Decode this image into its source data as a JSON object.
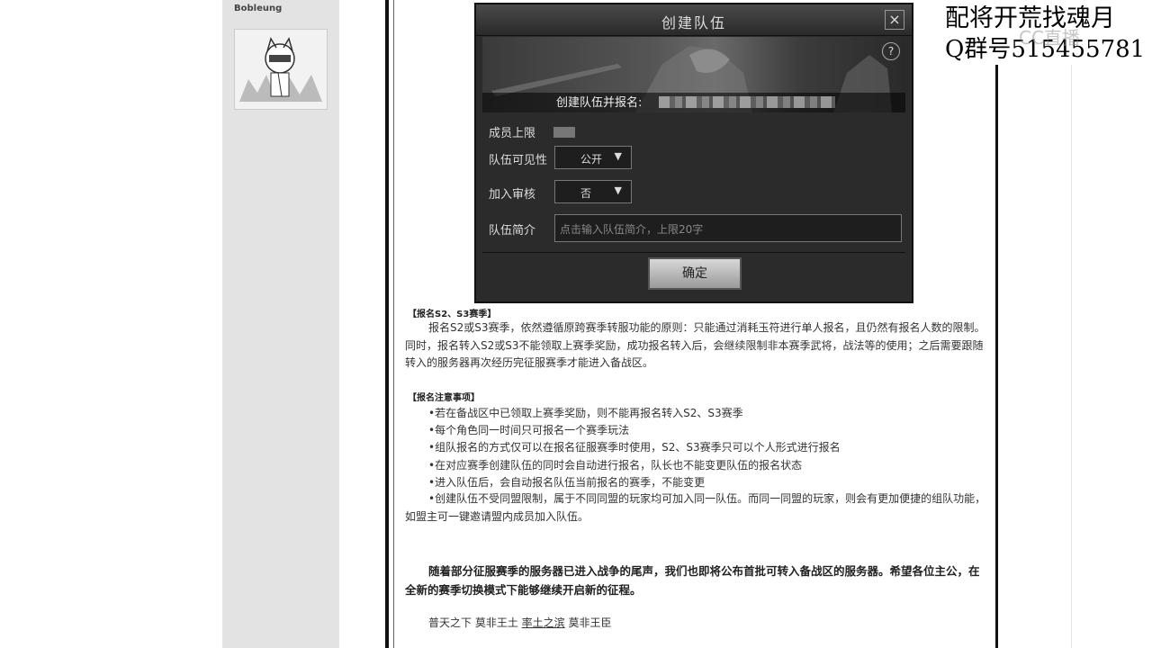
{
  "sidebar": {
    "username": "Bobleung"
  },
  "dialog": {
    "title": "创建队伍",
    "close_glyph": "×",
    "help_glyph": "?",
    "banner_label": "创建队伍并报名:",
    "fields": {
      "member_limit_label": "成员上限",
      "visibility_label": "队伍可见性",
      "visibility_value": "公开",
      "review_label": "加入审核",
      "review_value": "否",
      "intro_label": "队伍简介",
      "intro_placeholder": "点击输入队伍简介，上限20字"
    },
    "confirm_label": "确定",
    "dropdown_arrow": "▼"
  },
  "article": {
    "section1_title": "【报名S2、S3赛季】",
    "section1_body": "报名S2或S3赛季，依然遵循原跨赛季转服功能的原则：只能通过消耗玉符进行单人报名，且仍然有报名人数的限制。同时，报名转入S2或S3不能领取上赛季奖励，成功报名转入后，会继续限制非本赛季武将，战法等的使用；之后需要跟随转入的服务器再次经历完征服赛季才能进入备战区。",
    "section2_title": "【报名注意事项】",
    "bullets": [
      "•若在备战区中已领取上赛季奖励，则不能再报名转入S2、S3赛季",
      "•每个角色同一时间只可报名一个赛季玩法",
      "•组队报名的方式仅可以在报名征服赛季时使用，S2、S3赛季只可以个人形式进行报名",
      "•在对应赛季创建队伍的同时会自动进行报名，队长也不能变更队伍的报名状态",
      "•进入队伍后，会自动报名队伍当前报名的赛季，不能变更",
      "•创建队伍不受同盟限制，属于不同同盟的玩家均可加入同一队伍。而同一同盟的玩家，则会有更加便捷的组队功能，如盟主可一键邀请盟内成员加入队伍。"
    ],
    "closing_para": "随着部分征服赛季的服务器已进入战争的尾声，我们也即将公布首批可转入备战区的服务器。希望各位主公，在全新的赛季切换模式下能够继续开启新的征程。",
    "closing_line_a": "普天之下 莫非王土",
    "closing_line_b": "率土之滨",
    "closing_line_c": "莫非王臣"
  },
  "overlay": {
    "line1": "配将开荒找魂月",
    "line2": "Q群号515455781",
    "watermark": "CC直播"
  }
}
